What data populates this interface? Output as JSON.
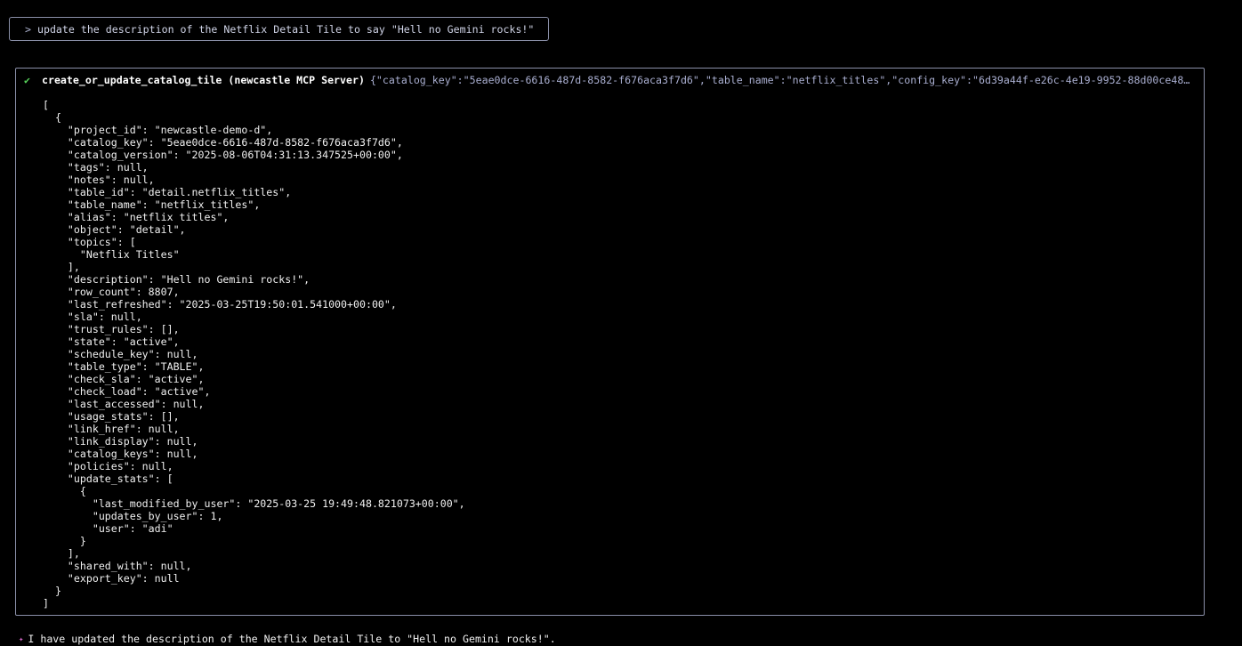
{
  "prompt": {
    "caret": ">",
    "text": "update the description of the Netflix Detail Tile to say \"Hell no Gemini rocks!\""
  },
  "tool_call": {
    "status_icon": "check-icon",
    "status_glyph": "✔",
    "name": "create_or_update_catalog_tile (newcastle MCP Server)",
    "args": "{\"catalog_key\":\"5eae0dce-6616-487d-8582-f676aca3f7d6\",\"table_name\":\"netflix_titles\",\"config_key\":\"6d39a44f-e26c-4e19-9952-88d00ce48…",
    "output": "[\n  {\n    \"project_id\": \"newcastle-demo-d\",\n    \"catalog_key\": \"5eae0dce-6616-487d-8582-f676aca3f7d6\",\n    \"catalog_version\": \"2025-08-06T04:31:13.347525+00:00\",\n    \"tags\": null,\n    \"notes\": null,\n    \"table_id\": \"detail.netflix_titles\",\n    \"table_name\": \"netflix_titles\",\n    \"alias\": \"netflix titles\",\n    \"object\": \"detail\",\n    \"topics\": [\n      \"Netflix Titles\"\n    ],\n    \"description\": \"Hell no Gemini rocks!\",\n    \"row_count\": 8807,\n    \"last_refreshed\": \"2025-03-25T19:50:01.541000+00:00\",\n    \"sla\": null,\n    \"trust_rules\": [],\n    \"state\": \"active\",\n    \"schedule_key\": null,\n    \"table_type\": \"TABLE\",\n    \"check_sla\": \"active\",\n    \"check_load\": \"active\",\n    \"last_accessed\": null,\n    \"usage_stats\": [],\n    \"link_href\": null,\n    \"link_display\": null,\n    \"catalog_keys\": null,\n    \"policies\": null,\n    \"update_stats\": [\n      {\n        \"last_modified_by_user\": \"2025-03-25 19:49:48.821073+00:00\",\n        \"updates_by_user\": 1,\n        \"user\": \"adi\"\n      }\n    ],\n    \"shared_with\": null,\n    \"export_key\": null\n  }\n]"
  },
  "response": {
    "icon": "sparkle-icon",
    "glyph": "✦",
    "text": "I have updated the description of the Netflix Detail Tile to \"Hell no Gemini rocks!\"."
  },
  "colors": {
    "background": "#000000",
    "border": "#8a8fa8",
    "success": "#58d45b",
    "args": "#a9aed0",
    "sparkle": "#d467c8"
  }
}
